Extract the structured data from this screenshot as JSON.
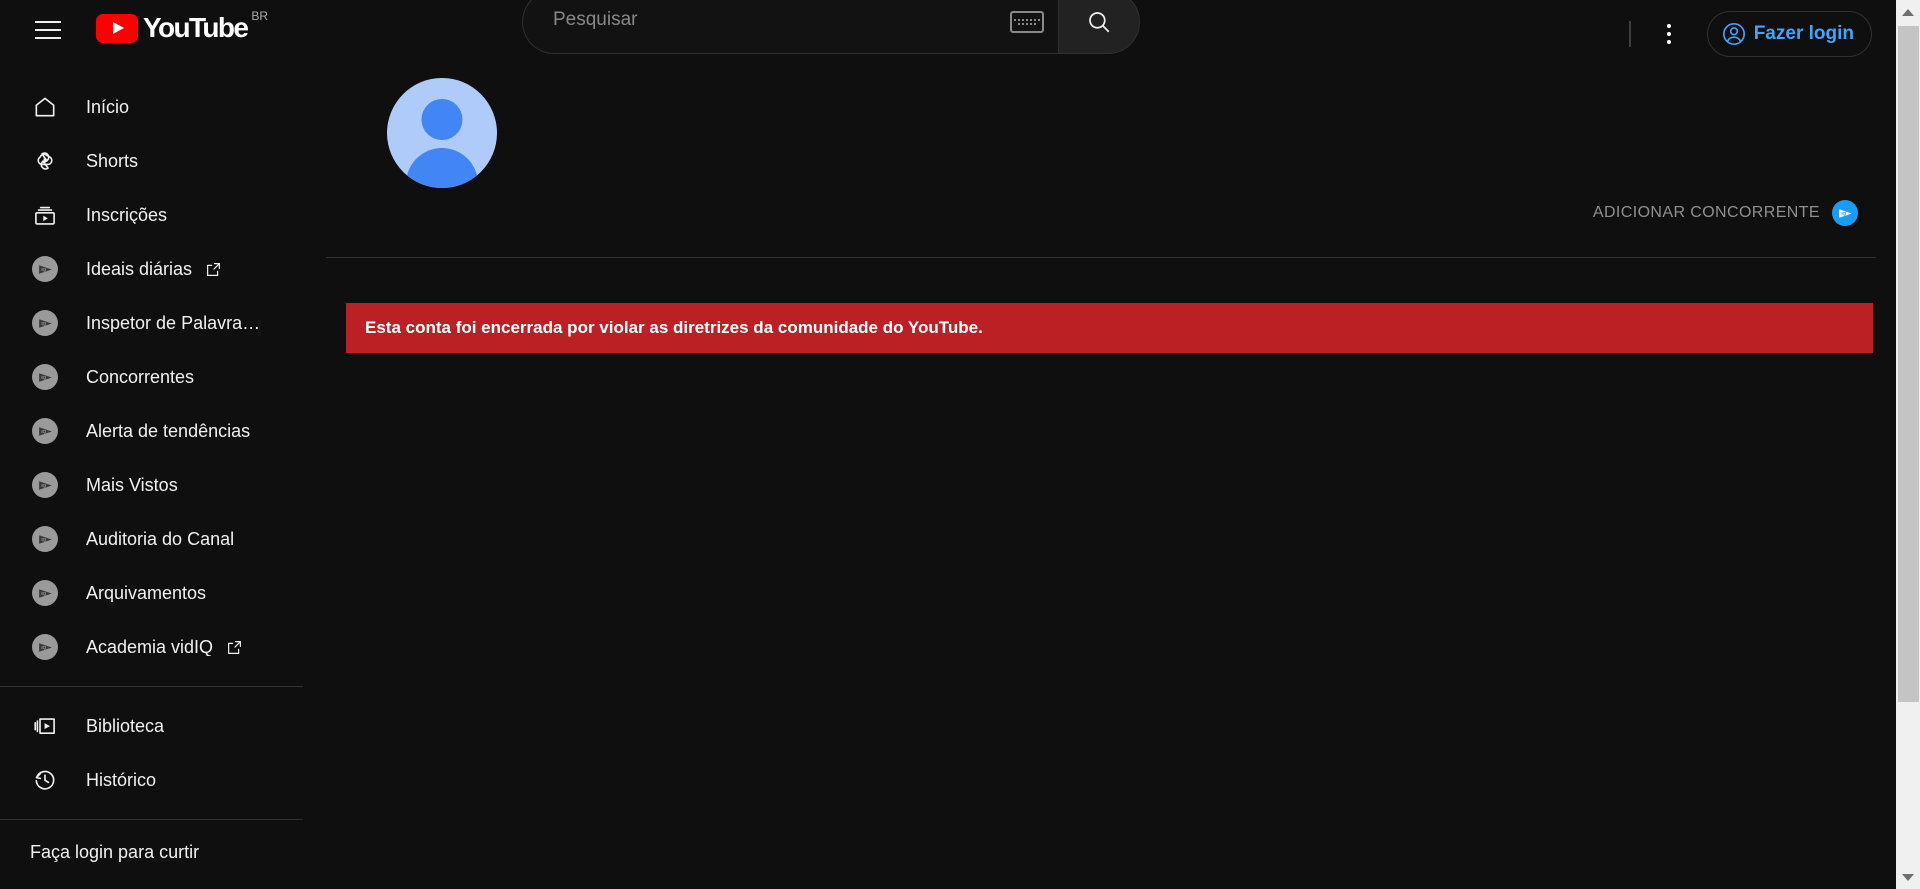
{
  "header": {
    "menu_icon": "hamburger-menu-icon",
    "logo_text": "YouTube",
    "logo_country": "BR",
    "search_placeholder": "Pesquisar",
    "search_value": "",
    "keyboard_icon": "keyboard-icon",
    "search_icon": "search-icon",
    "more_icon": "more-vertical-icon",
    "signin_label": "Fazer login",
    "signin_icon": "account-circle-icon",
    "accent_blue": "#3ea6ff"
  },
  "sidebar": {
    "primary": [
      {
        "label": "Início",
        "icon": "home-icon",
        "external": false
      },
      {
        "label": "Shorts",
        "icon": "shorts-icon",
        "external": false
      },
      {
        "label": "Inscrições",
        "icon": "subscriptions-icon",
        "external": false
      },
      {
        "label": "Ideais diárias",
        "icon": "vidiq-icon",
        "external": true
      },
      {
        "label": "Inspetor de Palavra…",
        "icon": "vidiq-icon",
        "external": false
      },
      {
        "label": "Concorrentes",
        "icon": "vidiq-icon",
        "external": false
      },
      {
        "label": "Alerta de tendências",
        "icon": "vidiq-icon",
        "external": false
      },
      {
        "label": "Mais Vistos",
        "icon": "vidiq-icon",
        "external": false
      },
      {
        "label": "Auditoria do Canal",
        "icon": "vidiq-icon",
        "external": false
      },
      {
        "label": "Arquivamentos",
        "icon": "vidiq-icon",
        "external": false
      },
      {
        "label": "Academia vidIQ",
        "icon": "vidiq-icon",
        "external": true
      }
    ],
    "secondary": [
      {
        "label": "Biblioteca",
        "icon": "library-icon",
        "external": false
      },
      {
        "label": "Histórico",
        "icon": "history-icon",
        "external": false
      }
    ],
    "section_title": "Faça login para curtir"
  },
  "main": {
    "avatar_icon": "default-avatar-icon",
    "add_competitor_label": "ADICIONAR CONCORRENTE",
    "add_competitor_icon": "vidiq-icon",
    "banner_text": "Esta conta foi encerrada por violar as diretrizes da comunidade do YouTube.",
    "banner_color": "#bb2124"
  },
  "scrollbar": {
    "up_icon": "scroll-up-arrow-icon",
    "down_icon": "scroll-down-arrow-icon"
  }
}
